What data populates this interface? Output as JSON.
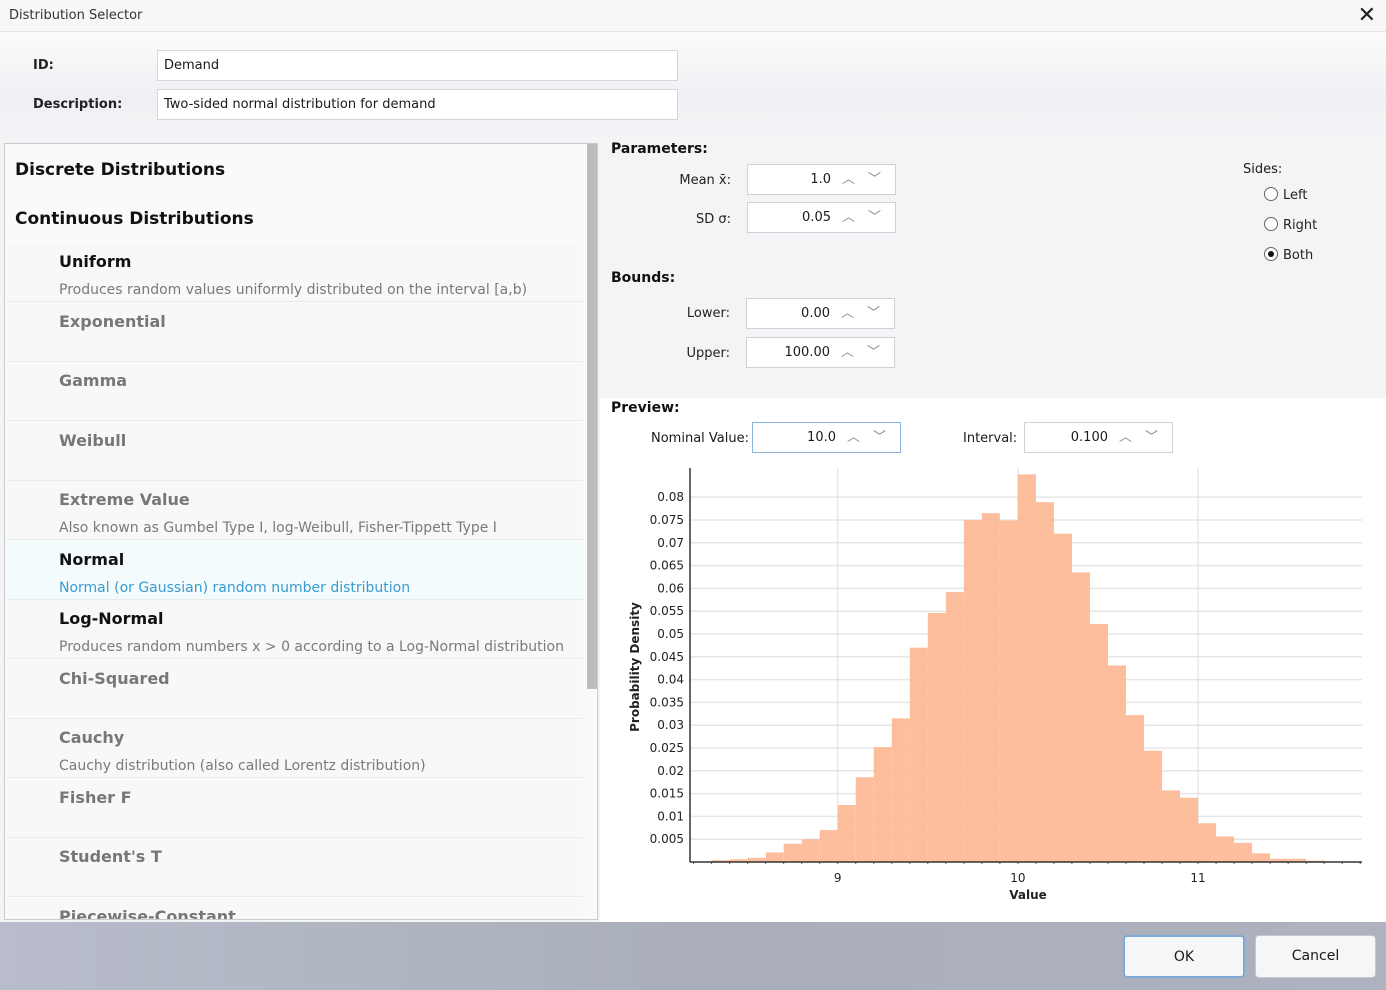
{
  "window": {
    "title": "Distribution Selector",
    "close_icon": "close-icon"
  },
  "form": {
    "id_label": "ID:",
    "id_value": "Demand",
    "desc_label": "Description:",
    "desc_value": "Two-sided normal distribution for demand"
  },
  "list": {
    "groups": [
      "Discrete Distributions",
      "Continuous Distributions"
    ],
    "items": [
      {
        "name": "Uniform",
        "desc": "Produces random values uniformly distributed on the interval [a,b)"
      },
      {
        "name": "Exponential",
        "desc": ""
      },
      {
        "name": "Gamma",
        "desc": ""
      },
      {
        "name": "Weibull",
        "desc": ""
      },
      {
        "name": "Extreme Value",
        "desc": "Also known as Gumbel Type I, log-Weibull, Fisher-Tippett Type I"
      },
      {
        "name": "Normal",
        "desc": "Normal (or Gaussian) random number distribution"
      },
      {
        "name": "Log-Normal",
        "desc": "Produces random numbers x > 0 according to a Log-Normal distribution"
      },
      {
        "name": "Chi-Squared",
        "desc": ""
      },
      {
        "name": "Cauchy",
        "desc": "Cauchy distribution (also called Lorentz distribution)"
      },
      {
        "name": "Fisher F",
        "desc": ""
      },
      {
        "name": "Student's T",
        "desc": ""
      },
      {
        "name": "Piecewise-Constant",
        "desc": ""
      }
    ],
    "selected": "Normal"
  },
  "parameters": {
    "title": "Parameters:",
    "mean_label": "Mean x̄:",
    "mean_value": "1.0",
    "sd_label": "SD σ:",
    "sd_value": "0.05"
  },
  "bounds": {
    "title": "Bounds:",
    "lower_label": "Lower:",
    "lower_value": "0.00",
    "upper_label": "Upper:",
    "upper_value": "100.00"
  },
  "sides": {
    "title": "Sides:",
    "options": [
      "Left",
      "Right",
      "Both"
    ],
    "selected": "Both"
  },
  "preview": {
    "title": "Preview:",
    "nominal_label": "Nominal Value:",
    "nominal_value": "10.0",
    "interval_label": "Interval:",
    "interval_value": "0.100"
  },
  "chart_data": {
    "type": "bar",
    "xlabel": "Value",
    "ylabel": "Probability Density",
    "xlim": [
      8.18,
      11.91
    ],
    "ylim": [
      0,
      0.0864
    ],
    "xticks": [
      "9",
      "10",
      "11"
    ],
    "yticks": [
      "0.005",
      "0.01",
      "0.015",
      "0.02",
      "0.025",
      "0.03",
      "0.035",
      "0.04",
      "0.045",
      "0.05",
      "0.055",
      "0.06",
      "0.065",
      "0.07",
      "0.075",
      "0.08"
    ],
    "grid": true,
    "bar_color": "#fcb894",
    "bin_width": 0.1,
    "bin_starts": [
      8.2,
      8.3,
      8.4,
      8.5,
      8.6,
      8.7,
      8.8,
      8.9,
      9.0,
      9.1,
      9.2,
      9.3,
      9.4,
      9.5,
      9.6,
      9.7,
      9.8,
      9.9,
      10.0,
      10.1,
      10.2,
      10.3,
      10.4,
      10.5,
      10.6,
      10.7,
      10.8,
      10.9,
      11.0,
      11.1,
      11.2,
      11.3,
      11.4,
      11.5,
      11.6,
      11.7,
      11.8
    ],
    "values": [
      0.0001,
      0.0004,
      0.0006,
      0.0009,
      0.0021,
      0.004,
      0.005,
      0.007,
      0.0125,
      0.0186,
      0.0252,
      0.0315,
      0.047,
      0.0546,
      0.0592,
      0.075,
      0.0765,
      0.0749,
      0.085,
      0.0789,
      0.072,
      0.0635,
      0.0522,
      0.0431,
      0.0322,
      0.0244,
      0.0157,
      0.0141,
      0.0085,
      0.0056,
      0.0042,
      0.0019,
      0.0007,
      0.0007,
      0.0003,
      0.0001,
      0.0001
    ]
  },
  "footer": {
    "ok": "OK",
    "cancel": "Cancel"
  }
}
